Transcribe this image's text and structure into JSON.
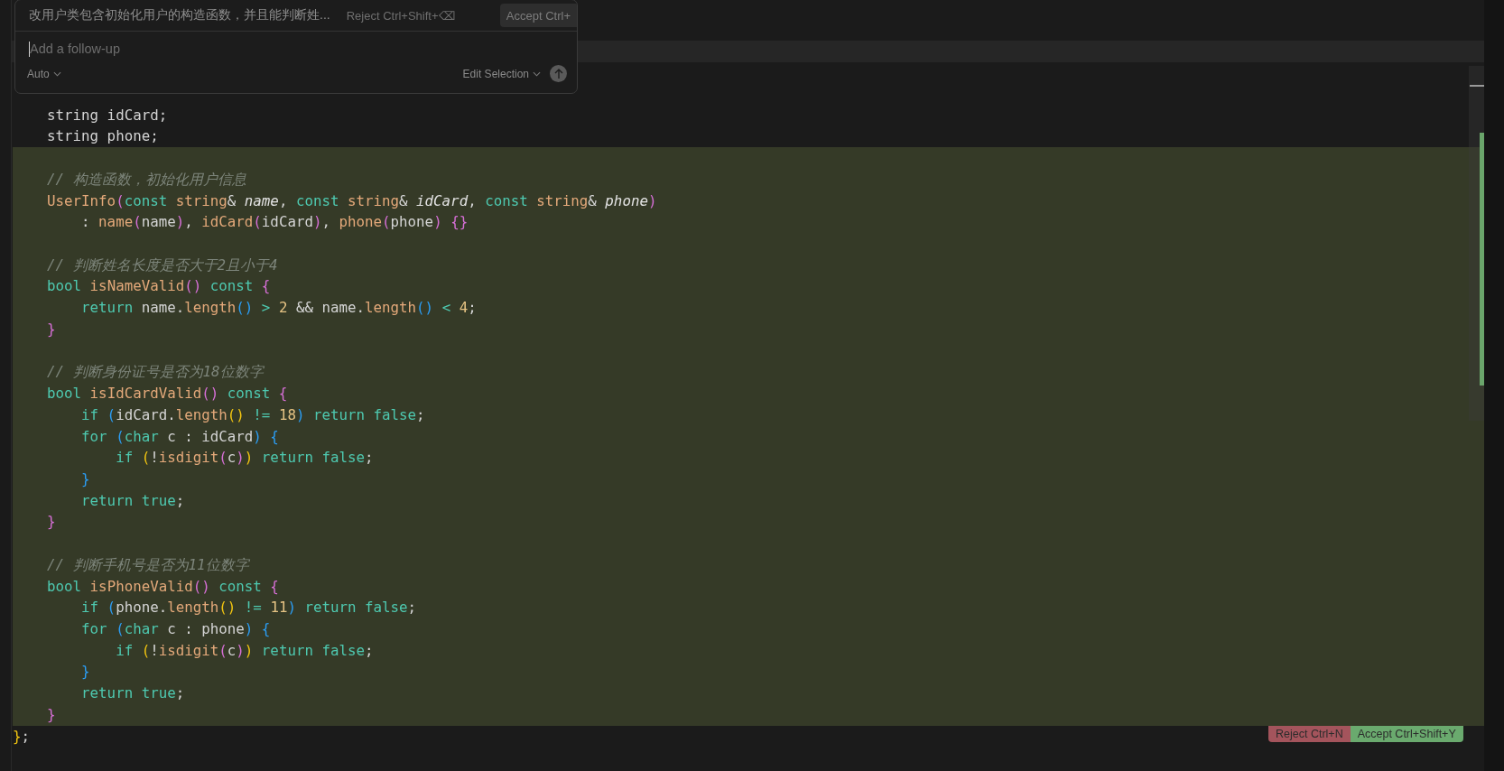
{
  "prompt_panel": {
    "prompt": "改用户类包含初始化用户的构造函数，并且能判断姓...",
    "reject_button": "Reject Ctrl+Shift+⌫",
    "accept_button": "Accept Ctrl+",
    "follow_up": {
      "placeholder": "Add a follow-up"
    },
    "model_selector": "Auto",
    "mode_selector": "Edit Selection"
  },
  "lines": [
    {
      "added": false
    },
    {
      "added": false,
      "tokens": [
        {
          "kind": "plain",
          "text": "    string idCard;"
        }
      ]
    },
    {
      "added": false,
      "tokens": [
        {
          "kind": "plain",
          "text": "    string phone;"
        }
      ]
    },
    {
      "added": true
    },
    {
      "added": true,
      "tokens": [
        {
          "kind": "comment",
          "text": "    // 构造函数，初始化用户信息"
        }
      ]
    },
    {
      "added": true,
      "tokens": [
        {
          "kind": "fn",
          "text": "    UserInfo"
        },
        {
          "kind": "p2",
          "text": "("
        },
        {
          "kind": "kw",
          "text": "const"
        },
        {
          "kind": "type",
          "text": " string"
        },
        {
          "kind": "plain",
          "text": "& "
        },
        {
          "kind": "param",
          "text": "name"
        },
        {
          "kind": "plain",
          "text": ", "
        },
        {
          "kind": "kw",
          "text": "const"
        },
        {
          "kind": "type",
          "text": " string"
        },
        {
          "kind": "plain",
          "text": "& "
        },
        {
          "kind": "param",
          "text": "idCard"
        },
        {
          "kind": "plain",
          "text": ", "
        },
        {
          "kind": "kw",
          "text": "const"
        },
        {
          "kind": "type",
          "text": " string"
        },
        {
          "kind": "plain",
          "text": "& "
        },
        {
          "kind": "param",
          "text": "phone"
        },
        {
          "kind": "p2",
          "text": ")"
        }
      ]
    },
    {
      "added": true,
      "tokens": [
        {
          "kind": "plain",
          "text": "        : "
        },
        {
          "kind": "fn",
          "text": "name"
        },
        {
          "kind": "p2",
          "text": "("
        },
        {
          "kind": "plain",
          "text": "name"
        },
        {
          "kind": "p2",
          "text": ")"
        },
        {
          "kind": "plain",
          "text": ", "
        },
        {
          "kind": "fn",
          "text": "idCard"
        },
        {
          "kind": "p2",
          "text": "("
        },
        {
          "kind": "plain",
          "text": "idCard"
        },
        {
          "kind": "p2",
          "text": ")"
        },
        {
          "kind": "plain",
          "text": ", "
        },
        {
          "kind": "fn",
          "text": "phone"
        },
        {
          "kind": "p2",
          "text": "("
        },
        {
          "kind": "plain",
          "text": "phone"
        },
        {
          "kind": "p2",
          "text": ")"
        },
        {
          "kind": "p2",
          "text": " {}"
        }
      ]
    },
    {
      "added": true
    },
    {
      "added": true,
      "tokens": [
        {
          "kind": "comment",
          "text": "    // 判断姓名长度是否大于2且小于4"
        }
      ]
    },
    {
      "added": true,
      "tokens": [
        {
          "kind": "kw",
          "text": "    bool"
        },
        {
          "kind": "fn",
          "text": " isNameValid"
        },
        {
          "kind": "p2",
          "text": "()"
        },
        {
          "kind": "kw",
          "text": " const"
        },
        {
          "kind": "p2",
          "text": " {"
        }
      ]
    },
    {
      "added": true,
      "tokens": [
        {
          "kind": "kw",
          "text": "        return"
        },
        {
          "kind": "plain",
          "text": " name."
        },
        {
          "kind": "fn",
          "text": "length"
        },
        {
          "kind": "p3",
          "text": "()"
        },
        {
          "kind": "op",
          "text": " >"
        },
        {
          "kind": "num",
          "text": " 2"
        },
        {
          "kind": "plain",
          "text": " && name."
        },
        {
          "kind": "fn",
          "text": "length"
        },
        {
          "kind": "p3",
          "text": "()"
        },
        {
          "kind": "op",
          "text": " <"
        },
        {
          "kind": "num",
          "text": " 4"
        },
        {
          "kind": "plain",
          "text": ";"
        }
      ]
    },
    {
      "added": true,
      "tokens": [
        {
          "kind": "p2",
          "text": "    }"
        }
      ]
    },
    {
      "added": true
    },
    {
      "added": true,
      "tokens": [
        {
          "kind": "comment",
          "text": "    // 判断身份证号是否为18位数字"
        }
      ]
    },
    {
      "added": true,
      "tokens": [
        {
          "kind": "kw",
          "text": "    bool"
        },
        {
          "kind": "fn",
          "text": " isIdCardValid"
        },
        {
          "kind": "p2",
          "text": "()"
        },
        {
          "kind": "kw",
          "text": " const"
        },
        {
          "kind": "p2",
          "text": " {"
        }
      ]
    },
    {
      "added": true,
      "tokens": [
        {
          "kind": "kw",
          "text": "        if"
        },
        {
          "kind": "p3",
          "text": " ("
        },
        {
          "kind": "plain",
          "text": "idCard."
        },
        {
          "kind": "fn",
          "text": "length"
        },
        {
          "kind": "p1",
          "text": "()"
        },
        {
          "kind": "op",
          "text": " !="
        },
        {
          "kind": "num",
          "text": " 18"
        },
        {
          "kind": "p3",
          "text": ")"
        },
        {
          "kind": "kw",
          "text": " return"
        },
        {
          "kind": "kw",
          "text": " false"
        },
        {
          "kind": "plain",
          "text": ";"
        }
      ]
    },
    {
      "added": true,
      "tokens": [
        {
          "kind": "kw",
          "text": "        for"
        },
        {
          "kind": "p3",
          "text": " ("
        },
        {
          "kind": "kw",
          "text": "char"
        },
        {
          "kind": "plain",
          "text": " c : idCard"
        },
        {
          "kind": "p3",
          "text": ")"
        },
        {
          "kind": "p3",
          "text": " {"
        }
      ]
    },
    {
      "added": true,
      "tokens": [
        {
          "kind": "kw",
          "text": "            if"
        },
        {
          "kind": "p1",
          "text": " ("
        },
        {
          "kind": "plain",
          "text": "!"
        },
        {
          "kind": "fn",
          "text": "isdigit"
        },
        {
          "kind": "p2",
          "text": "("
        },
        {
          "kind": "plain",
          "text": "c"
        },
        {
          "kind": "p2",
          "text": ")"
        },
        {
          "kind": "p1",
          "text": ")"
        },
        {
          "kind": "kw",
          "text": " return"
        },
        {
          "kind": "kw",
          "text": " false"
        },
        {
          "kind": "plain",
          "text": ";"
        }
      ]
    },
    {
      "added": true,
      "tokens": [
        {
          "kind": "p3",
          "text": "        }"
        }
      ]
    },
    {
      "added": true,
      "tokens": [
        {
          "kind": "kw",
          "text": "        return"
        },
        {
          "kind": "kw",
          "text": " true"
        },
        {
          "kind": "plain",
          "text": ";"
        }
      ]
    },
    {
      "added": true,
      "tokens": [
        {
          "kind": "p2",
          "text": "    }"
        }
      ]
    },
    {
      "added": true
    },
    {
      "added": true,
      "tokens": [
        {
          "kind": "comment",
          "text": "    // 判断手机号是否为11位数字"
        }
      ]
    },
    {
      "added": true,
      "tokens": [
        {
          "kind": "kw",
          "text": "    bool"
        },
        {
          "kind": "fn",
          "text": " isPhoneValid"
        },
        {
          "kind": "p2",
          "text": "()"
        },
        {
          "kind": "kw",
          "text": " const"
        },
        {
          "kind": "p2",
          "text": " {"
        }
      ]
    },
    {
      "added": true,
      "tokens": [
        {
          "kind": "kw",
          "text": "        if"
        },
        {
          "kind": "p3",
          "text": " ("
        },
        {
          "kind": "plain",
          "text": "phone."
        },
        {
          "kind": "fn",
          "text": "length"
        },
        {
          "kind": "p1",
          "text": "()"
        },
        {
          "kind": "op",
          "text": " !="
        },
        {
          "kind": "num",
          "text": " 11"
        },
        {
          "kind": "p3",
          "text": ")"
        },
        {
          "kind": "kw",
          "text": " return"
        },
        {
          "kind": "kw",
          "text": " false"
        },
        {
          "kind": "plain",
          "text": ";"
        }
      ]
    },
    {
      "added": true,
      "tokens": [
        {
          "kind": "kw",
          "text": "        for"
        },
        {
          "kind": "p3",
          "text": " ("
        },
        {
          "kind": "kw",
          "text": "char"
        },
        {
          "kind": "plain",
          "text": " c : phone"
        },
        {
          "kind": "p3",
          "text": ")"
        },
        {
          "kind": "p3",
          "text": " {"
        }
      ]
    },
    {
      "added": true,
      "tokens": [
        {
          "kind": "kw",
          "text": "            if"
        },
        {
          "kind": "p1",
          "text": " ("
        },
        {
          "kind": "plain",
          "text": "!"
        },
        {
          "kind": "fn",
          "text": "isdigit"
        },
        {
          "kind": "p2",
          "text": "("
        },
        {
          "kind": "plain",
          "text": "c"
        },
        {
          "kind": "p2",
          "text": ")"
        },
        {
          "kind": "p1",
          "text": ")"
        },
        {
          "kind": "kw",
          "text": " return"
        },
        {
          "kind": "kw",
          "text": " false"
        },
        {
          "kind": "plain",
          "text": ";"
        }
      ]
    },
    {
      "added": true,
      "tokens": [
        {
          "kind": "p3",
          "text": "        }"
        }
      ]
    },
    {
      "added": true,
      "tokens": [
        {
          "kind": "kw",
          "text": "        return"
        },
        {
          "kind": "kw",
          "text": " true"
        },
        {
          "kind": "plain",
          "text": ";"
        }
      ]
    },
    {
      "added": true,
      "tokens": [
        {
          "kind": "p2",
          "text": "    }"
        }
      ]
    },
    {
      "added": false,
      "tokens": [
        {
          "kind": "p1",
          "text": "}"
        },
        {
          "kind": "plain",
          "text": ";"
        }
      ]
    }
  ],
  "diff_actions": {
    "reject_button": "Reject Ctrl+N",
    "accept_button": "Accept Ctrl+Shift+Y"
  }
}
